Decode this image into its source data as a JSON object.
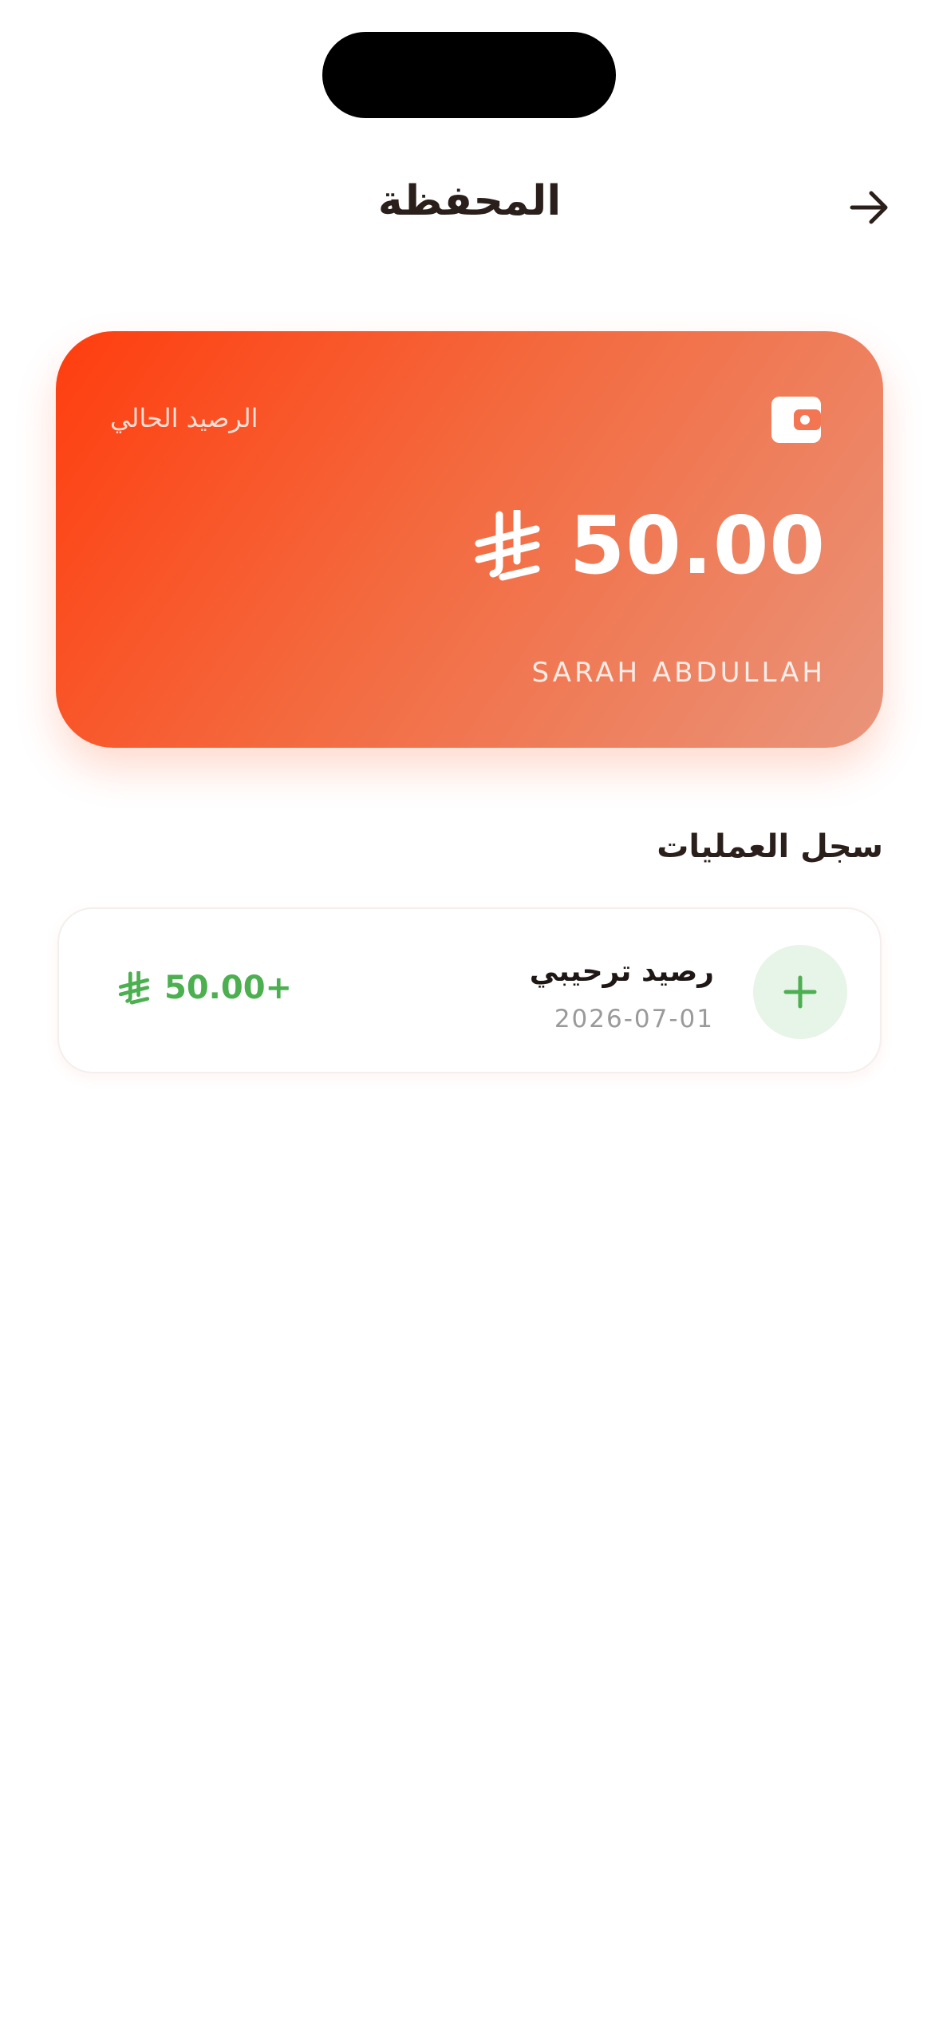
{
  "header": {
    "title": "المحفظة",
    "back_icon": "arrow-right-icon"
  },
  "wallet_card": {
    "balance_label": "الرصيد الحالي",
    "balance": "50.00",
    "currency_icon": "saudi-riyal-icon",
    "wallet_icon": "wallet-icon",
    "cardholder": "SARAH ABDULLAH",
    "gradient": [
      "#ff3d0e",
      "#e9957b"
    ]
  },
  "history": {
    "title": "سجل العمليات",
    "transactions": [
      {
        "title": "رصيد ترحيبي",
        "date": "2026-07-01",
        "amount": "50.00+",
        "icon": "plus-icon",
        "color": "#4caf50"
      }
    ]
  }
}
